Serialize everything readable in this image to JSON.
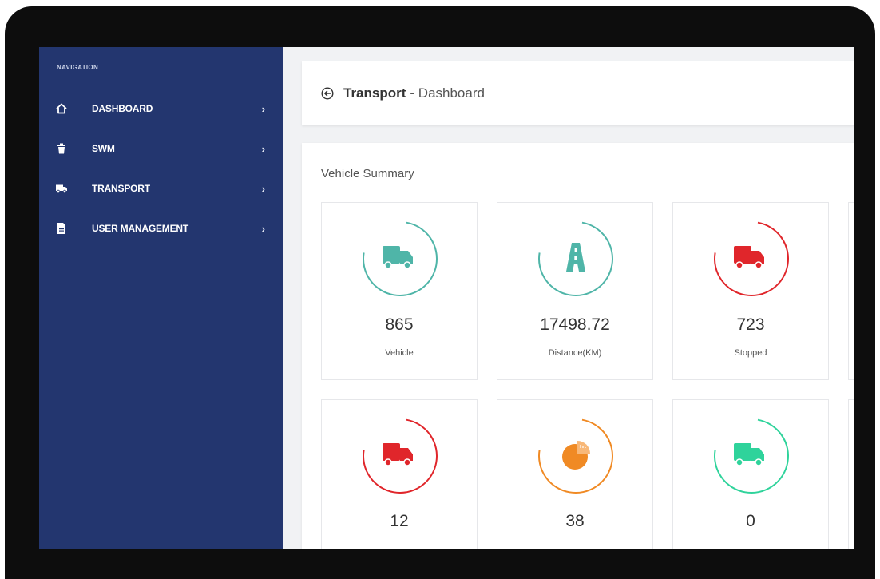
{
  "sidebar": {
    "heading": "NAVIGATION",
    "items": [
      {
        "label": "DASHBOARD",
        "icon": "home-icon",
        "chevron": "›"
      },
      {
        "label": "SWM",
        "icon": "trash-icon",
        "chevron": "›"
      },
      {
        "label": "TRANSPORT",
        "icon": "truck-icon",
        "chevron": "›"
      },
      {
        "label": "USER MANAGEMENT",
        "icon": "file-icon",
        "chevron": "›"
      }
    ]
  },
  "header": {
    "title_strong": "Transport",
    "title_rest": "- Dashboard",
    "back_icon": "back-arrow-circle-icon"
  },
  "summary": {
    "title": "Vehicle Summary",
    "tiles": [
      {
        "value": "865",
        "label": "Vehicle",
        "icon": "truck-icon",
        "color": "#4fb5a8"
      },
      {
        "value": "17498.72",
        "label": "Distance(KM)",
        "icon": "road-icon",
        "color": "#4fb5a8"
      },
      {
        "value": "723",
        "label": "Stopped",
        "icon": "truck-icon",
        "color": "#e0262b"
      },
      {
        "value": "12",
        "label": "",
        "icon": "truck-icon",
        "color": "#e0262b"
      },
      {
        "value": "38",
        "label": "",
        "icon": "pie-chart-icon",
        "color": "#f08a24"
      },
      {
        "value": "0",
        "label": "",
        "icon": "truck-icon",
        "color": "#2fd39b"
      }
    ]
  },
  "colors": {
    "sidebar_bg": "#23366f",
    "screen_bg": "#f1f2f4",
    "teal": "#4fb5a8",
    "red": "#e0262b",
    "orange": "#f08a24",
    "green": "#2fd39b"
  }
}
